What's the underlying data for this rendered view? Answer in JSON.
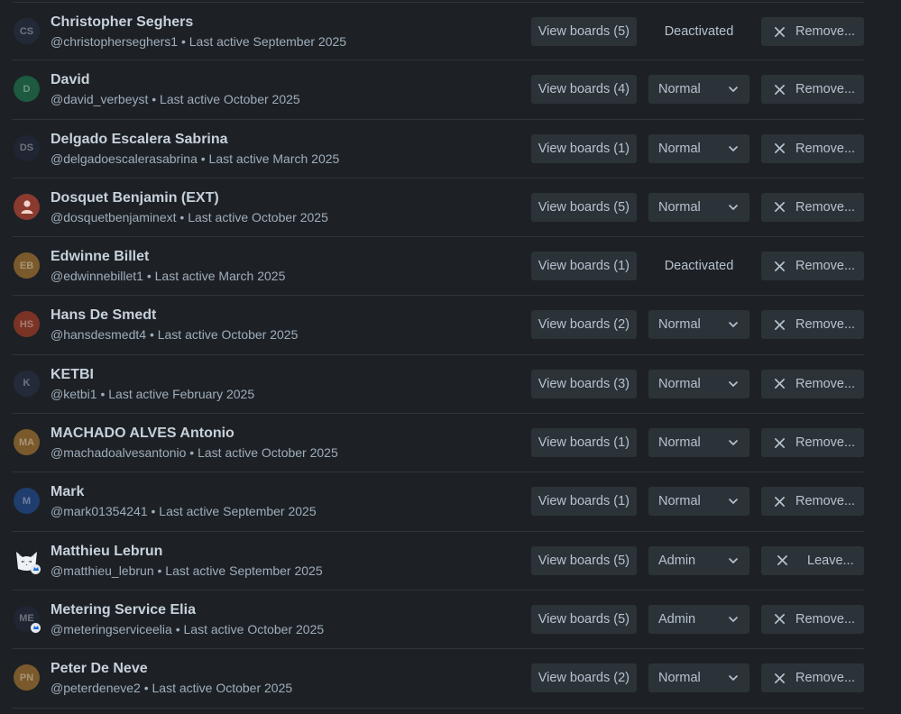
{
  "members": [
    {
      "name": "Christopher Seghers",
      "meta": "@christopherseghers1 • Last active September 2025",
      "initials": "CS",
      "avatar_color": "#222a38",
      "view_label": "View boards (5)",
      "role": "Deactivated",
      "role_type": "static",
      "action_label": "Remove..."
    },
    {
      "name": "David",
      "meta": "@david_verbeyst • Last active October 2025",
      "initials": "D",
      "avatar_color": "#1d5a3f",
      "view_label": "View boards (4)",
      "role": "Normal",
      "role_type": "select",
      "action_label": "Remove..."
    },
    {
      "name": "Delgado Escalera Sabrina",
      "meta": "@delgadoescalerasabrina • Last active March 2025",
      "initials": "DS",
      "avatar_color": "#1f2533",
      "view_label": "View boards (1)",
      "role": "Normal",
      "role_type": "select",
      "action_label": "Remove..."
    },
    {
      "name": "Dosquet Benjamin (EXT)",
      "meta": "@dosquetbenjaminext • Last active October 2025",
      "initials": "",
      "avatar_color": "#8a3a2e",
      "view_label": "View boards (5)",
      "role": "Normal",
      "role_type": "select",
      "action_label": "Remove..."
    },
    {
      "name": "Edwinne Billet",
      "meta": "@edwinnebillet1 • Last active March 2025",
      "initials": "EB",
      "avatar_color": "#7a5a2c",
      "view_label": "View boards (1)",
      "role": "Deactivated",
      "role_type": "static",
      "action_label": "Remove..."
    },
    {
      "name": "Hans De Smedt",
      "meta": "@hansdesmedt4 • Last active October 2025",
      "initials": "HS",
      "avatar_color": "#7a3324",
      "view_label": "View boards (2)",
      "role": "Normal",
      "role_type": "select",
      "action_label": "Remove..."
    },
    {
      "name": "KETBI",
      "meta": "@ketbi1 • Last active February 2025",
      "initials": "K",
      "avatar_color": "#232b3a",
      "view_label": "View boards (3)",
      "role": "Normal",
      "role_type": "select",
      "action_label": "Remove..."
    },
    {
      "name": "MACHADO ALVES Antonio",
      "meta": "@machadoalvesantonio • Last active October 2025",
      "initials": "MA",
      "avatar_color": "#7a5a2c",
      "view_label": "View boards (1)",
      "role": "Normal",
      "role_type": "select",
      "action_label": "Remove..."
    },
    {
      "name": "Mark",
      "meta": "@mark01354241 • Last active September 2025",
      "initials": "M",
      "avatar_color": "#1f3d6e",
      "view_label": "View boards (1)",
      "role": "Normal",
      "role_type": "select",
      "action_label": "Remove..."
    },
    {
      "name": "Matthieu Lebrun",
      "meta": "@matthieu_lebrun • Last active September 2025",
      "initials": "",
      "avatar_color": "#1d2125",
      "view_label": "View boards (5)",
      "role": "Admin",
      "role_type": "select",
      "action_label": "Leave..."
    },
    {
      "name": "Metering Service Elia",
      "meta": "@meteringserviceelia • Last active October 2025",
      "initials": "ME",
      "avatar_color": "#1f2533",
      "view_label": "View boards (5)",
      "role": "Admin",
      "role_type": "select",
      "action_label": "Remove..."
    },
    {
      "name": "Peter De Neve",
      "meta": "@peterdeneve2 • Last active October 2025",
      "initials": "PN",
      "avatar_color": "#7a5a2c",
      "view_label": "View boards (2)",
      "role": "Normal",
      "role_type": "select",
      "action_label": "Remove..."
    }
  ],
  "icons": {
    "chevron": "chevron-down-icon",
    "close": "close-icon",
    "person": "person-icon",
    "cat": "cat-avatar-icon",
    "admin_badge": "admin-badge-icon"
  }
}
